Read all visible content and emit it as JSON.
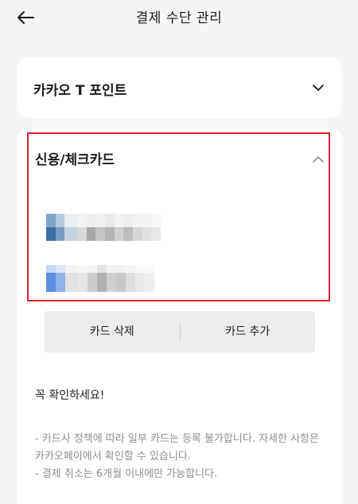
{
  "header": {
    "title": "결제 수단 관리",
    "back_icon": "back-arrow-icon"
  },
  "sections": {
    "kakao_point": {
      "label": "카카오 T 포인트",
      "chevron": "chevron-down-icon"
    },
    "credit_card": {
      "label": "신용/체크카드",
      "chevron": "chevron-up-icon"
    }
  },
  "actions": {
    "delete_label": "카드 삭제",
    "add_label": "카드 추가"
  },
  "notice": {
    "title": "꼭 확인하세요!",
    "line1": "- 카드사 정책에 따라 일부 카드는 등록 불가합니다. 자세한 사항은 카카오페이에서 확인할 수 있습니다.",
    "line2": "- 결제 취소는 6개월 이내에만 가능합니다."
  },
  "colors": {
    "highlight_border": "#d6232d",
    "background": "#f5f5f7",
    "card_background": "#ffffff",
    "button_bar": "#ececef"
  }
}
